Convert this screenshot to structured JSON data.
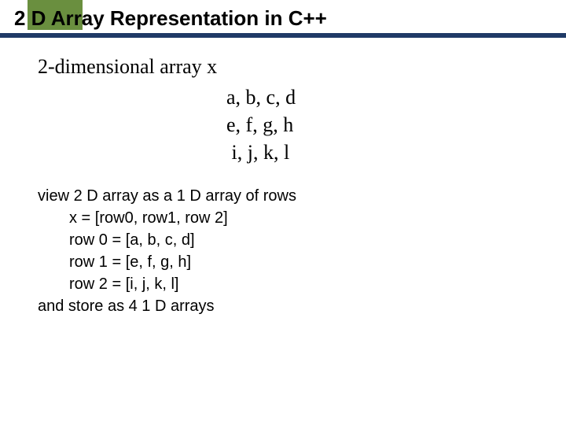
{
  "title": "2 D Array Representation in C++",
  "intro": "2-dimensional array x",
  "array": {
    "row0": "a, b, c, d",
    "row1": "e, f, g, h",
    "row2": " i, j, k, l"
  },
  "body": {
    "line1": "view 2 D array as a 1 D array of rows",
    "x_line": "x = [row0, row1, row 2]",
    "r0": "row 0 = [a, b, c, d]",
    "r1": "row 1 = [e, f, g, h]",
    "r2": "row 2 = [i, j, k, l]",
    "last": "and store as 4 1 D arrays"
  }
}
